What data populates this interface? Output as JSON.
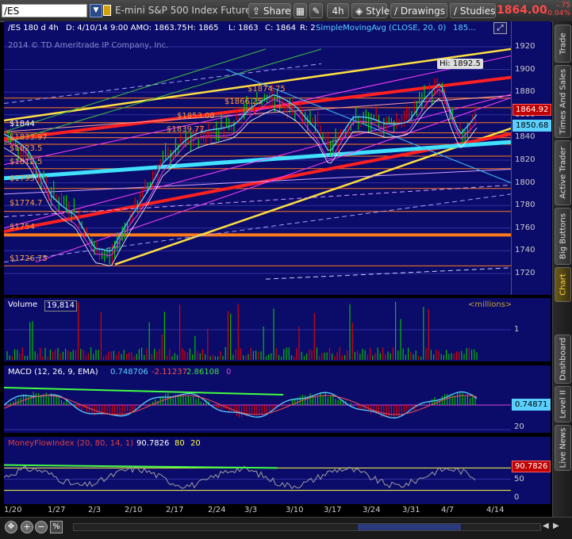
{
  "toolbar": {
    "symbol": "/ES",
    "description": "E-mini S&P 500 Index Futures,ET...",
    "share_label": "Share",
    "timeframe": "4h",
    "style_label": "Style",
    "drawings_label": "Drawings",
    "studies_label": "Studies",
    "last_price": "1864.00",
    "net_change": "-.75",
    "pct_change": "-0.04%"
  },
  "price_header": {
    "symbol_period": "/ES 180 d 4h",
    "date": "D: 4/10/14 9:00 AM",
    "open": "O: 1863.75",
    "high": "H: 1865",
    "low": "L: 1863",
    "close": "C: 1864",
    "range": "R: 2",
    "study": "SimpleMovingAvg (CLOSE, 20, 0)",
    "study_value": "185...",
    "copyright": "2014 © TD Ameritrade IP Company, Inc."
  },
  "price_axis": {
    "ticks": [
      "1920",
      "1900",
      "1880",
      "1860",
      "1840",
      "1820",
      "1800",
      "1780",
      "1760",
      "1740",
      "1720"
    ],
    "last_tag": "1864.92",
    "sma_tag": "1850.68",
    "hi_label": "Hi: 1892.5"
  },
  "price_levels": [
    "$1874.75",
    "$1866.25",
    "$1853.08",
    "$1839.77",
    "$1844",
    "$1833.97",
    "$1823.5",
    "$1812.5",
    "$1795",
    "$1774.7",
    "$1754",
    "$1726.75"
  ],
  "volume": {
    "title": "Volume",
    "value": "19,814",
    "unit": "<millions>",
    "axis_tick": "1"
  },
  "macd": {
    "title": "MACD (12, 26, 9, EMA)",
    "value": "0.748706",
    "avg": "-2.11237",
    "diff": "2.86108",
    "extra": "0",
    "tag": "0.74871",
    "axis_tick": "20"
  },
  "mfi": {
    "title": "MoneyFlowIndex (20, 80, 14, 1)",
    "value": "90.7826",
    "ob": "80",
    "os": "20",
    "tag": "90.7826",
    "ticks": [
      "100",
      "50",
      "0"
    ]
  },
  "dates": [
    "1/20",
    "1/27",
    "2/3",
    "2/10",
    "2/17",
    "2/24",
    "3/3",
    "3/10",
    "3/17",
    "3/24",
    "3/31",
    "4/7",
    "4/14"
  ],
  "sidebar": [
    "Trade",
    "Times And Sales",
    "Active Trader",
    "Big Buttons",
    "Chart",
    "Dashboard",
    "Level II",
    "Live News"
  ],
  "colors": {
    "pane": "#0b0b6a",
    "up": "#00c000",
    "down": "#e00000",
    "accent": "#ffd040"
  }
}
